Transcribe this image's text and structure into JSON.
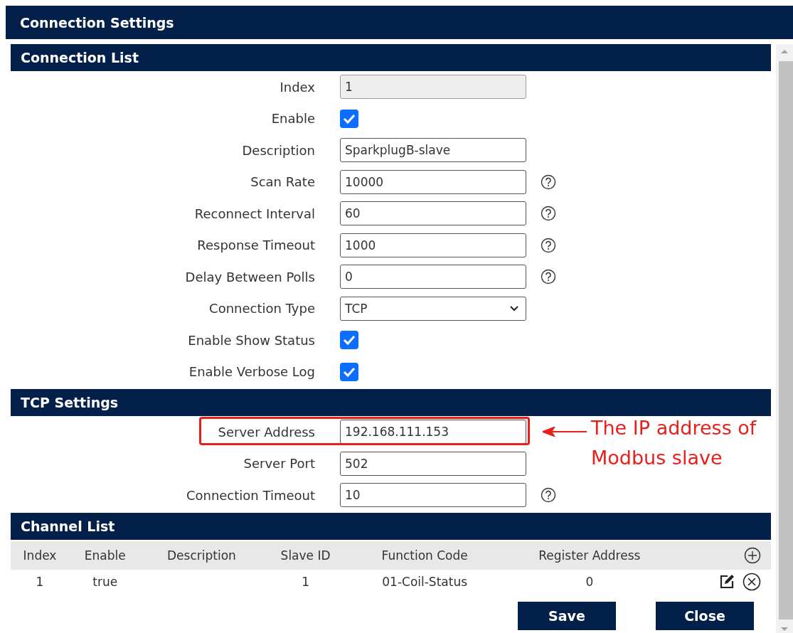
{
  "window": {
    "title": "Connection Settings"
  },
  "connection_list": {
    "title": "Connection List",
    "fields": [
      {
        "label": "Index",
        "kind": "readonly",
        "value": "1",
        "help": false
      },
      {
        "label": "Enable",
        "kind": "checkbox",
        "checked": true,
        "help": false
      },
      {
        "label": "Description",
        "kind": "text",
        "value": "SparkplugB-slave",
        "help": false
      },
      {
        "label": "Scan Rate",
        "kind": "text",
        "value": "10000",
        "help": true
      },
      {
        "label": "Reconnect Interval",
        "kind": "text",
        "value": "60",
        "help": true
      },
      {
        "label": "Response Timeout",
        "kind": "text",
        "value": "1000",
        "help": true
      },
      {
        "label": "Delay Between Polls",
        "kind": "text",
        "value": "0",
        "help": true
      },
      {
        "label": "Connection Type",
        "kind": "select",
        "value": "TCP",
        "help": false
      },
      {
        "label": "Enable Show Status",
        "kind": "checkbox",
        "checked": true,
        "help": false
      },
      {
        "label": "Enable Verbose Log",
        "kind": "checkbox",
        "checked": true,
        "help": false
      }
    ]
  },
  "tcp_settings": {
    "title": "TCP Settings",
    "fields": [
      {
        "label": "Server Address",
        "kind": "text",
        "value": "192.168.111.153",
        "help": false,
        "highlighted": true,
        "annotation": "The IP address of Modbus slave"
      },
      {
        "label": "Server Port",
        "kind": "text",
        "value": "502",
        "help": false,
        "highlighted": false
      },
      {
        "label": "Connection Timeout",
        "kind": "text",
        "value": "10",
        "help": true,
        "highlighted": false
      }
    ]
  },
  "channel_list": {
    "title": "Channel List",
    "columns": [
      "Index",
      "Enable",
      "Description",
      "Slave ID",
      "Function Code",
      "Register Address"
    ],
    "rows": [
      {
        "cells": [
          "1",
          "true",
          "",
          "1",
          "01-Coil-Status",
          "0"
        ]
      }
    ]
  },
  "buttons": [
    "Save",
    "Close"
  ]
}
